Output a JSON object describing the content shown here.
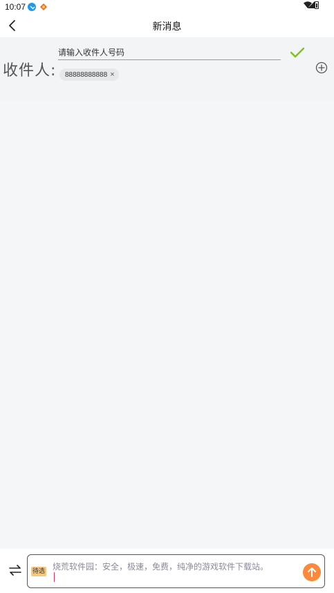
{
  "status_bar": {
    "time": "10:07"
  },
  "header": {
    "title": "新消息"
  },
  "recipient": {
    "label": "收件人:",
    "input_placeholder": "请输入收件人号码",
    "chips": [
      {
        "number": "88888888888"
      }
    ]
  },
  "composer": {
    "tag_label": "待选",
    "message_placeholder": "烧荒软件园：安全，极速，免费，纯净的游戏软件下载站。"
  },
  "colors": {
    "confirm_check": "#7cc21b",
    "send_button": "#fb8a3c",
    "tag_background": "#f7c97c",
    "caret": "#d9326b"
  },
  "icons": {
    "back": "chevron-left-icon",
    "confirm": "checkmark-icon",
    "add": "plus-circle-icon",
    "switch": "swap-arrows-icon",
    "send": "arrow-up-icon"
  }
}
